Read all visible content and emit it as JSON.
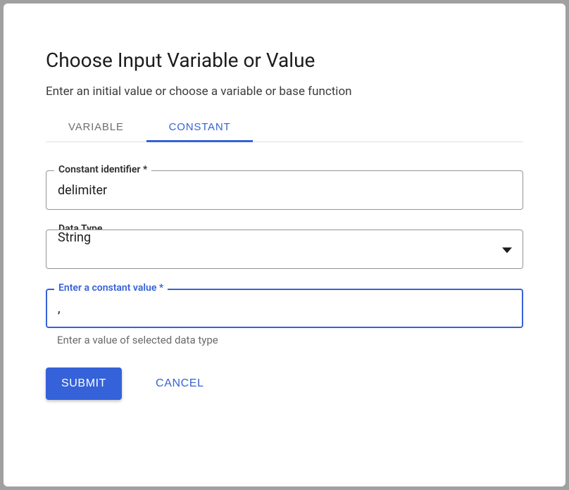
{
  "dialog": {
    "title": "Choose Input Variable or Value",
    "subtitle": "Enter an initial value or choose a variable or base function"
  },
  "tabs": {
    "variable": "VARIABLE",
    "constant": "CONSTANT"
  },
  "fields": {
    "identifier": {
      "label": "Constant identifier *",
      "value": "delimiter"
    },
    "dataType": {
      "label": "Data Type",
      "value": "String"
    },
    "constantValue": {
      "label": "Enter a constant value *",
      "value": ",",
      "helper": "Enter a value of selected data type"
    }
  },
  "actions": {
    "submit": "SUBMIT",
    "cancel": "CANCEL"
  }
}
